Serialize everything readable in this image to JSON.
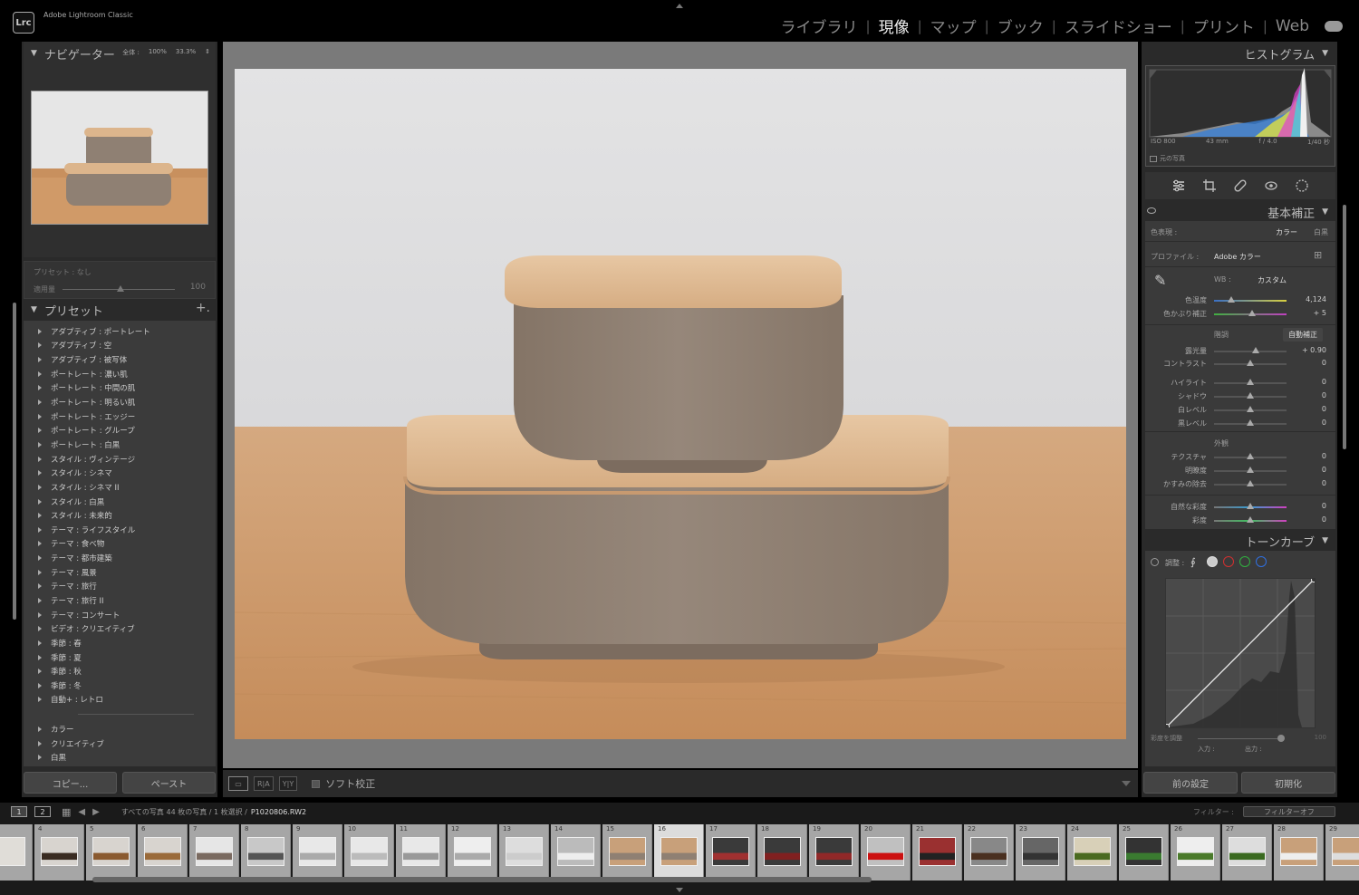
{
  "app": {
    "logo": "Lrc",
    "title": "Adobe Lightroom Classic"
  },
  "modules": [
    {
      "label": "ライブラリ",
      "active": false
    },
    {
      "label": "現像",
      "active": true
    },
    {
      "label": "マップ",
      "active": false
    },
    {
      "label": "ブック",
      "active": false
    },
    {
      "label": "スライドショー",
      "active": false
    },
    {
      "label": "プリント",
      "active": false
    },
    {
      "label": "Web",
      "active": false
    }
  ],
  "navigator": {
    "title": "ナビゲーター",
    "zoom_fit": "全体 :",
    "zoom_100": "100%",
    "zoom_33": "33.3%"
  },
  "preset_amount": {
    "preset_label": "プリセット : なし",
    "amount_label": "適用量",
    "amount_value": "100"
  },
  "presets": {
    "title": "プリセット",
    "add": "+.",
    "items": [
      "アダプティブ : ポートレート",
      "アダプティブ : 空",
      "アダプティブ : 被写体",
      "ポートレート : 濃い肌",
      "ポートレート : 中間の肌",
      "ポートレート : 明るい肌",
      "ポートレート : エッジー",
      "ポートレート : グループ",
      "ポートレート : 白黒",
      "スタイル : ヴィンテージ",
      "スタイル : シネマ",
      "スタイル : シネマ II",
      "スタイル : 白黒",
      "スタイル : 未来的",
      "テーマ : ライフスタイル",
      "テーマ : 食べ物",
      "テーマ : 都市建築",
      "テーマ : 風景",
      "テーマ : 旅行",
      "テーマ : 旅行 II",
      "テーマ : コンサート",
      "ビデオ : クリエイティブ",
      "季節 : 春",
      "季節 : 夏",
      "季節 : 秋",
      "季節 : 冬",
      "自動+ : レトロ"
    ],
    "groups": [
      "カラー",
      "クリエイティブ",
      "白黒"
    ]
  },
  "left_buttons": {
    "copy": "コピー...",
    "paste": "ペースト"
  },
  "toolbar": {
    "view_ba": "R|A",
    "view_yy": "Y|Y",
    "softproof": "ソフト校正"
  },
  "histogram": {
    "title": "ヒストグラム",
    "iso": "ISO 800",
    "focal": "43 mm",
    "aperture": "f / 4.0",
    "shutter": "1/40 秒",
    "original": "元の写真"
  },
  "basic": {
    "title": "基本補正",
    "treatment_label": "色表現 :",
    "treatment_color": "カラー",
    "treatment_bw": "白黒",
    "profile_label": "プロファイル :",
    "profile_value": "Adobe カラー",
    "wb_label": "WB :",
    "wb_value": "カスタム",
    "temp_label": "色温度",
    "temp_value": "4,124",
    "tint_label": "色かぶり補正",
    "tint_value": "+ 5",
    "tone_label": "階調",
    "auto_label": "自動補正",
    "exposure_label": "露光量",
    "exposure_value": "+ 0.90",
    "contrast_label": "コントラスト",
    "contrast_value": "0",
    "highlights_label": "ハイライト",
    "highlights_value": "0",
    "shadows_label": "シャドウ",
    "shadows_value": "0",
    "whites_label": "白レベル",
    "whites_value": "0",
    "blacks_label": "黒レベル",
    "blacks_value": "0",
    "presence_label": "外観",
    "texture_label": "テクスチャ",
    "texture_value": "0",
    "clarity_label": "明瞭度",
    "clarity_value": "0",
    "dehaze_label": "かすみの除去",
    "dehaze_value": "0",
    "vibrance_label": "自然な彩度",
    "vibrance_value": "0",
    "saturation_label": "彩度",
    "saturation_value": "0"
  },
  "tone_curve": {
    "title": "トーンカーブ",
    "adjust_label": "調整 :",
    "adjust_sat_label": "彩度を調整",
    "adjust_sat_value": "100",
    "input_label": "入力 :",
    "output_label": "出力 :"
  },
  "right_buttons": {
    "previous": "前の設定",
    "reset": "初期化"
  },
  "filmstrip_bar": {
    "monitor1": "1",
    "monitor2": "2",
    "path": "すべての写真  44 枚の写真 / 1 枚選択 /",
    "filename": "P1020806.RW2",
    "filter_label": "フィルター :",
    "filter_value": "フィルターオフ"
  },
  "filmstrip": {
    "numbers": [
      "4",
      "5",
      "6",
      "7",
      "8",
      "9",
      "10",
      "11",
      "12",
      "13",
      "14",
      "15",
      "16",
      "17",
      "18",
      "19",
      "20",
      "21",
      "22",
      "23",
      "24",
      "25",
      "26",
      "27",
      "28",
      "29"
    ],
    "selected": "16"
  },
  "colors": {
    "accent_active": "#eeeeee",
    "panel_bg": "#3a3a3a",
    "center_bg": "#7a7a7a"
  }
}
